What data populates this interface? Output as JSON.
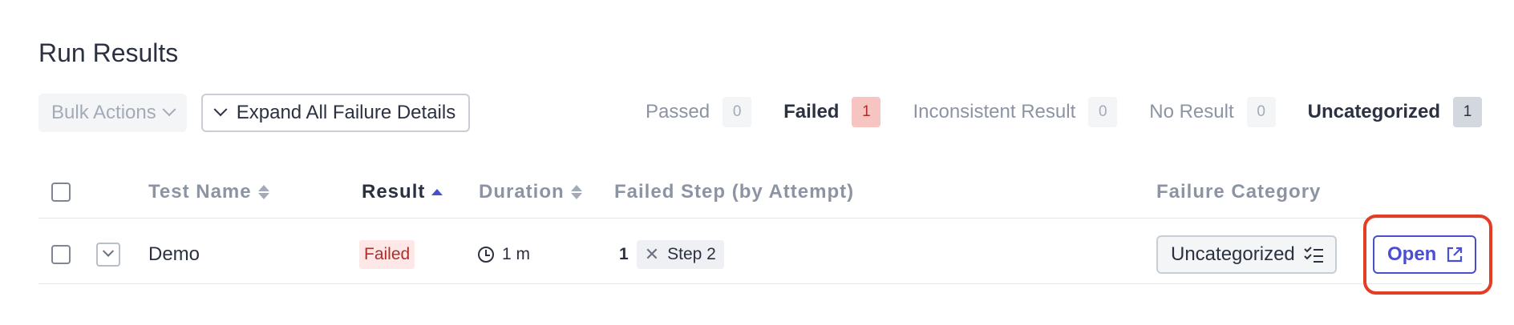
{
  "page": {
    "title": "Run Results"
  },
  "toolbar": {
    "bulk_actions_label": "Bulk Actions",
    "expand_all_label": "Expand All Failure Details"
  },
  "filters": [
    {
      "label": "Passed",
      "count": "0"
    },
    {
      "label": "Failed",
      "count": "1"
    },
    {
      "label": "Inconsistent Result",
      "count": "0"
    },
    {
      "label": "No Result",
      "count": "0"
    },
    {
      "label": "Uncategorized",
      "count": "1"
    }
  ],
  "table": {
    "columns": {
      "test_name": "Test Name",
      "result": "Result",
      "duration": "Duration",
      "failed_step": "Failed Step (by Attempt)",
      "failure_category": "Failure Category"
    },
    "sorted_column": "Result",
    "sort_direction": "ascending",
    "rows": [
      {
        "name": "Demo",
        "result": "Failed",
        "duration": "1 m",
        "attempt": "1",
        "failed_step": "Step 2",
        "category": "Uncategorized",
        "action": "Open"
      }
    ]
  },
  "colors": {
    "accent": "#4a4fcf",
    "failed_text": "#b32d27",
    "failed_bg": "#fde8e7",
    "highlight": "#e33d26"
  }
}
